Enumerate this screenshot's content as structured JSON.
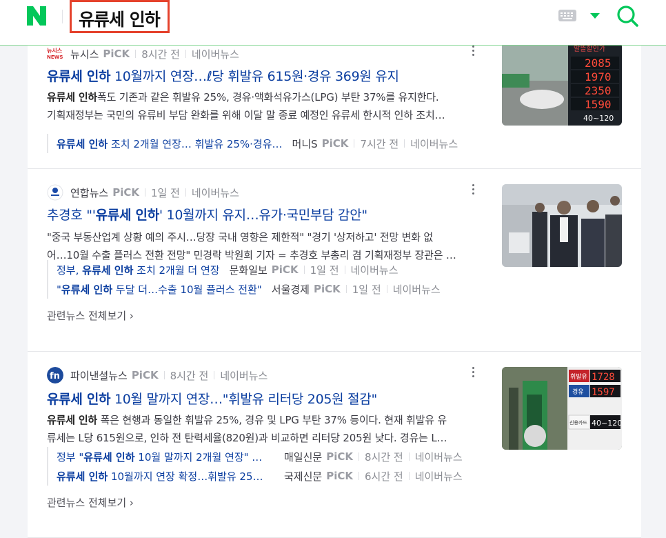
{
  "header": {
    "query": "유류세 인하"
  },
  "articles": [
    {
      "press": "뉴시스",
      "pick": "PiCK",
      "time": "8시간 전",
      "source": "네이버뉴스",
      "logo_text": "뉴시스 NEWS",
      "title_bold": "유류세 인하",
      "title_rest": " 10월까지 연장…ℓ당 휘발유 615원·경유 369원 유지",
      "desc_bold": "유류세 인하",
      "desc_line1": "폭도 기존과 같은 휘발유 25%, 경유·액화석유가스(LPG) 부탄 37%를 유지한다.",
      "desc_line2": "기획재정부는 국민의 유류비 부담 완화를 위해 이달 말 종료 예정인 유류세 한시적 인하 조치…",
      "thumb_texts": [
        "알뜰할인가",
        "2085",
        "1970",
        "2350",
        "1590",
        "40~120"
      ],
      "related": [
        {
          "title_pre": "",
          "title_bold": "유류세 인하",
          "title_rest": " 조치 2개월 연장… 휘발유 25%·경유…",
          "press": "머니S",
          "pick": "PiCK",
          "time": "7시간 전",
          "source": "네이버뉴스"
        }
      ]
    },
    {
      "press": "연합뉴스",
      "pick": "PiCK",
      "time": "1일 전",
      "source": "네이버뉴스",
      "title_pre": "추경호 \"'",
      "title_bold": "유류세 인하",
      "title_rest": "' 10월까지 유지…유가·국민부담 감안\"",
      "desc_line1": "\"중국 부동산업계 상황 예의 주시…당장 국내 영향은 제한적\" \"경기 '상저하고' 전망 변화 없",
      "desc_line2": "어…10월 수출 플러스 전환 전망\" 민경락 박원희 기자 = 추경호 부총리 겸 기획재정부 장관은 …",
      "related": [
        {
          "title_pre": "정부, ",
          "title_bold": "유류세 인하",
          "title_rest": " 조치 2개월 더 연장",
          "press": "문화일보",
          "pick": "PiCK",
          "time": "1일 전",
          "source": "네이버뉴스"
        },
        {
          "title_pre": "\"",
          "title_bold": "유류세 인하",
          "title_rest": " 두달 더…수출 10월 플러스 전환\"",
          "press": "서울경제",
          "pick": "PiCK",
          "time": "1일 전",
          "source": "네이버뉴스"
        }
      ],
      "more_label": "관련뉴스 전체보기 ›"
    },
    {
      "press": "파이낸셜뉴스",
      "pick": "PiCK",
      "time": "8시간 전",
      "source": "네이버뉴스",
      "logo_text": "fn",
      "title_bold": "유류세 인하",
      "title_rest": " 10월 말까지 연장…\"휘발유 리터당 205원 절감\"",
      "desc_bold": "유류세 인하",
      "desc_line1": " 폭은 현행과 동일한 휘발유 25%, 경유 및 LPG 부탄 37% 등이다. 현재 휘발유 유",
      "desc_line2": "류세는 L당 615원으로, 인하 전 탄력세율(820원)과 비교하면 리터당 205원 낮다. 경유는 L…",
      "thumb_texts": [
        "휘발유",
        "1728",
        "경유",
        "1597",
        "40~120",
        "신용카드"
      ],
      "related": [
        {
          "title_pre": "정부 \"",
          "title_bold": "유류세 인하",
          "title_rest": " 10월 말까지 2개월 연장\" …",
          "press": "매일신문",
          "pick": "PiCK",
          "time": "8시간 전",
          "source": "네이버뉴스"
        },
        {
          "title_pre": "",
          "title_bold": "유류세 인하",
          "title_rest": " 10월까지 연장 확정…휘발유 25…",
          "press": "국제신문",
          "pick": "PiCK",
          "time": "6시간 전",
          "source": "네이버뉴스"
        }
      ],
      "more_label": "관련뉴스 전체보기 ›"
    }
  ]
}
